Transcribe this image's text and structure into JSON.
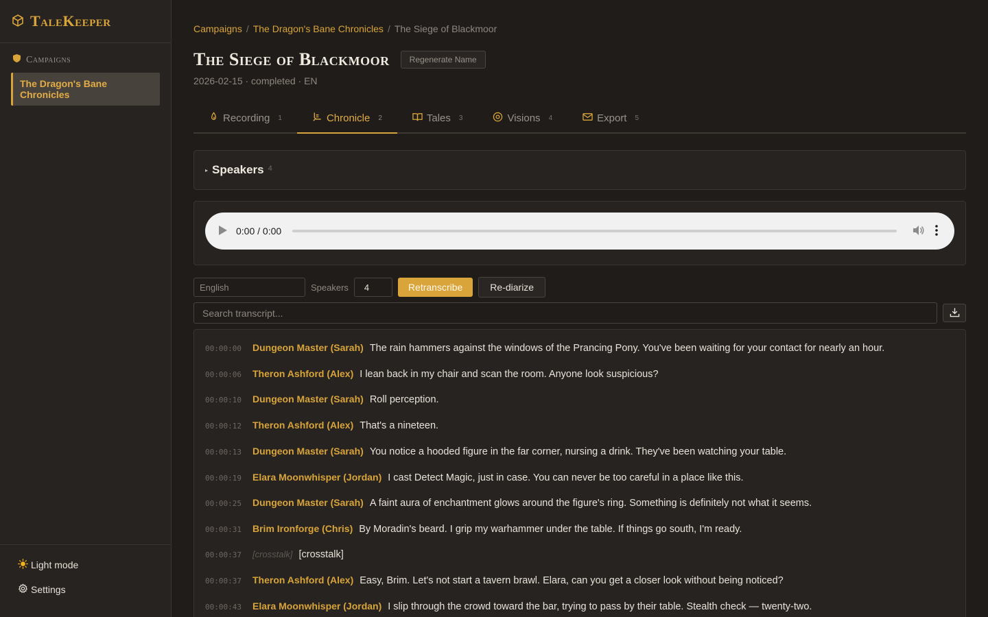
{
  "app": {
    "name": "TaleKeeper"
  },
  "sidebar": {
    "heading": "Campaigns",
    "campaigns": [
      {
        "label": "The Dragon's Bane Chronicles"
      }
    ],
    "bottom": {
      "light_mode": "Light mode",
      "settings": "Settings"
    }
  },
  "breadcrumb": {
    "items": [
      "Campaigns",
      "The Dragon's Bane Chronicles"
    ],
    "current": "The Siege of Blackmoor",
    "separator": "/"
  },
  "session": {
    "title": "The Siege of Blackmoor",
    "regenerate_label": "Regenerate Name",
    "meta": "2026-02-15 · completed · EN"
  },
  "tabs": [
    {
      "label": "Recording",
      "num": "1",
      "icon": "microphone-icon"
    },
    {
      "label": "Chronicle",
      "num": "2",
      "icon": "quill-icon",
      "active": true
    },
    {
      "label": "Tales",
      "num": "3",
      "icon": "book-icon"
    },
    {
      "label": "Visions",
      "num": "4",
      "icon": "eye-icon"
    },
    {
      "label": "Export",
      "num": "5",
      "icon": "envelope-icon"
    }
  ],
  "speakers_panel": {
    "label": "Speakers",
    "count": "4"
  },
  "audio": {
    "time": "0:00 / 0:00",
    "progress": 0
  },
  "controls": {
    "language_placeholder": "English",
    "speakers_label": "Speakers",
    "speakers_value": "4",
    "retranscribe": "Retranscribe",
    "rediarize": "Re-diarize"
  },
  "search": {
    "placeholder": "Search transcript..."
  },
  "transcript": [
    {
      "time": "00:00:00",
      "speaker": "Dungeon Master (Sarah)",
      "text": "The rain hammers against the windows of the Prancing Pony. You've been waiting for your contact for nearly an hour."
    },
    {
      "time": "00:00:06",
      "speaker": "Theron Ashford (Alex)",
      "text": "I lean back in my chair and scan the room. Anyone look suspicious?"
    },
    {
      "time": "00:00:10",
      "speaker": "Dungeon Master (Sarah)",
      "text": "Roll perception."
    },
    {
      "time": "00:00:12",
      "speaker": "Theron Ashford (Alex)",
      "text": "That's a nineteen."
    },
    {
      "time": "00:00:13",
      "speaker": "Dungeon Master (Sarah)",
      "text": "You notice a hooded figure in the far corner, nursing a drink. They've been watching your table."
    },
    {
      "time": "00:00:19",
      "speaker": "Elara Moonwhisper (Jordan)",
      "text": "I cast Detect Magic, just in case. You can never be too careful in a place like this."
    },
    {
      "time": "00:00:25",
      "speaker": "Dungeon Master (Sarah)",
      "text": "A faint aura of enchantment glows around the figure's ring. Something is definitely not what it seems."
    },
    {
      "time": "00:00:31",
      "speaker": "Brim Ironforge (Chris)",
      "text": "By Moradin's beard. I grip my warhammer under the table. If things go south, I'm ready."
    },
    {
      "time": "00:00:37",
      "speaker": "[crosstalk]",
      "text": "[crosstalk]",
      "crosstalk": true
    },
    {
      "time": "00:00:37",
      "speaker": "Theron Ashford (Alex)",
      "text": "Easy, Brim. Let's not start a tavern brawl. Elara, can you get a closer look without being noticed?"
    },
    {
      "time": "00:00:43",
      "speaker": "Elara Moonwhisper (Jordan)",
      "text": "I slip through the crowd toward the bar, trying to pass by their table. Stealth check — twenty-two."
    }
  ],
  "colors": {
    "accent": "#d9a43a",
    "background": "#1f1c1a",
    "panel": "#272321"
  }
}
